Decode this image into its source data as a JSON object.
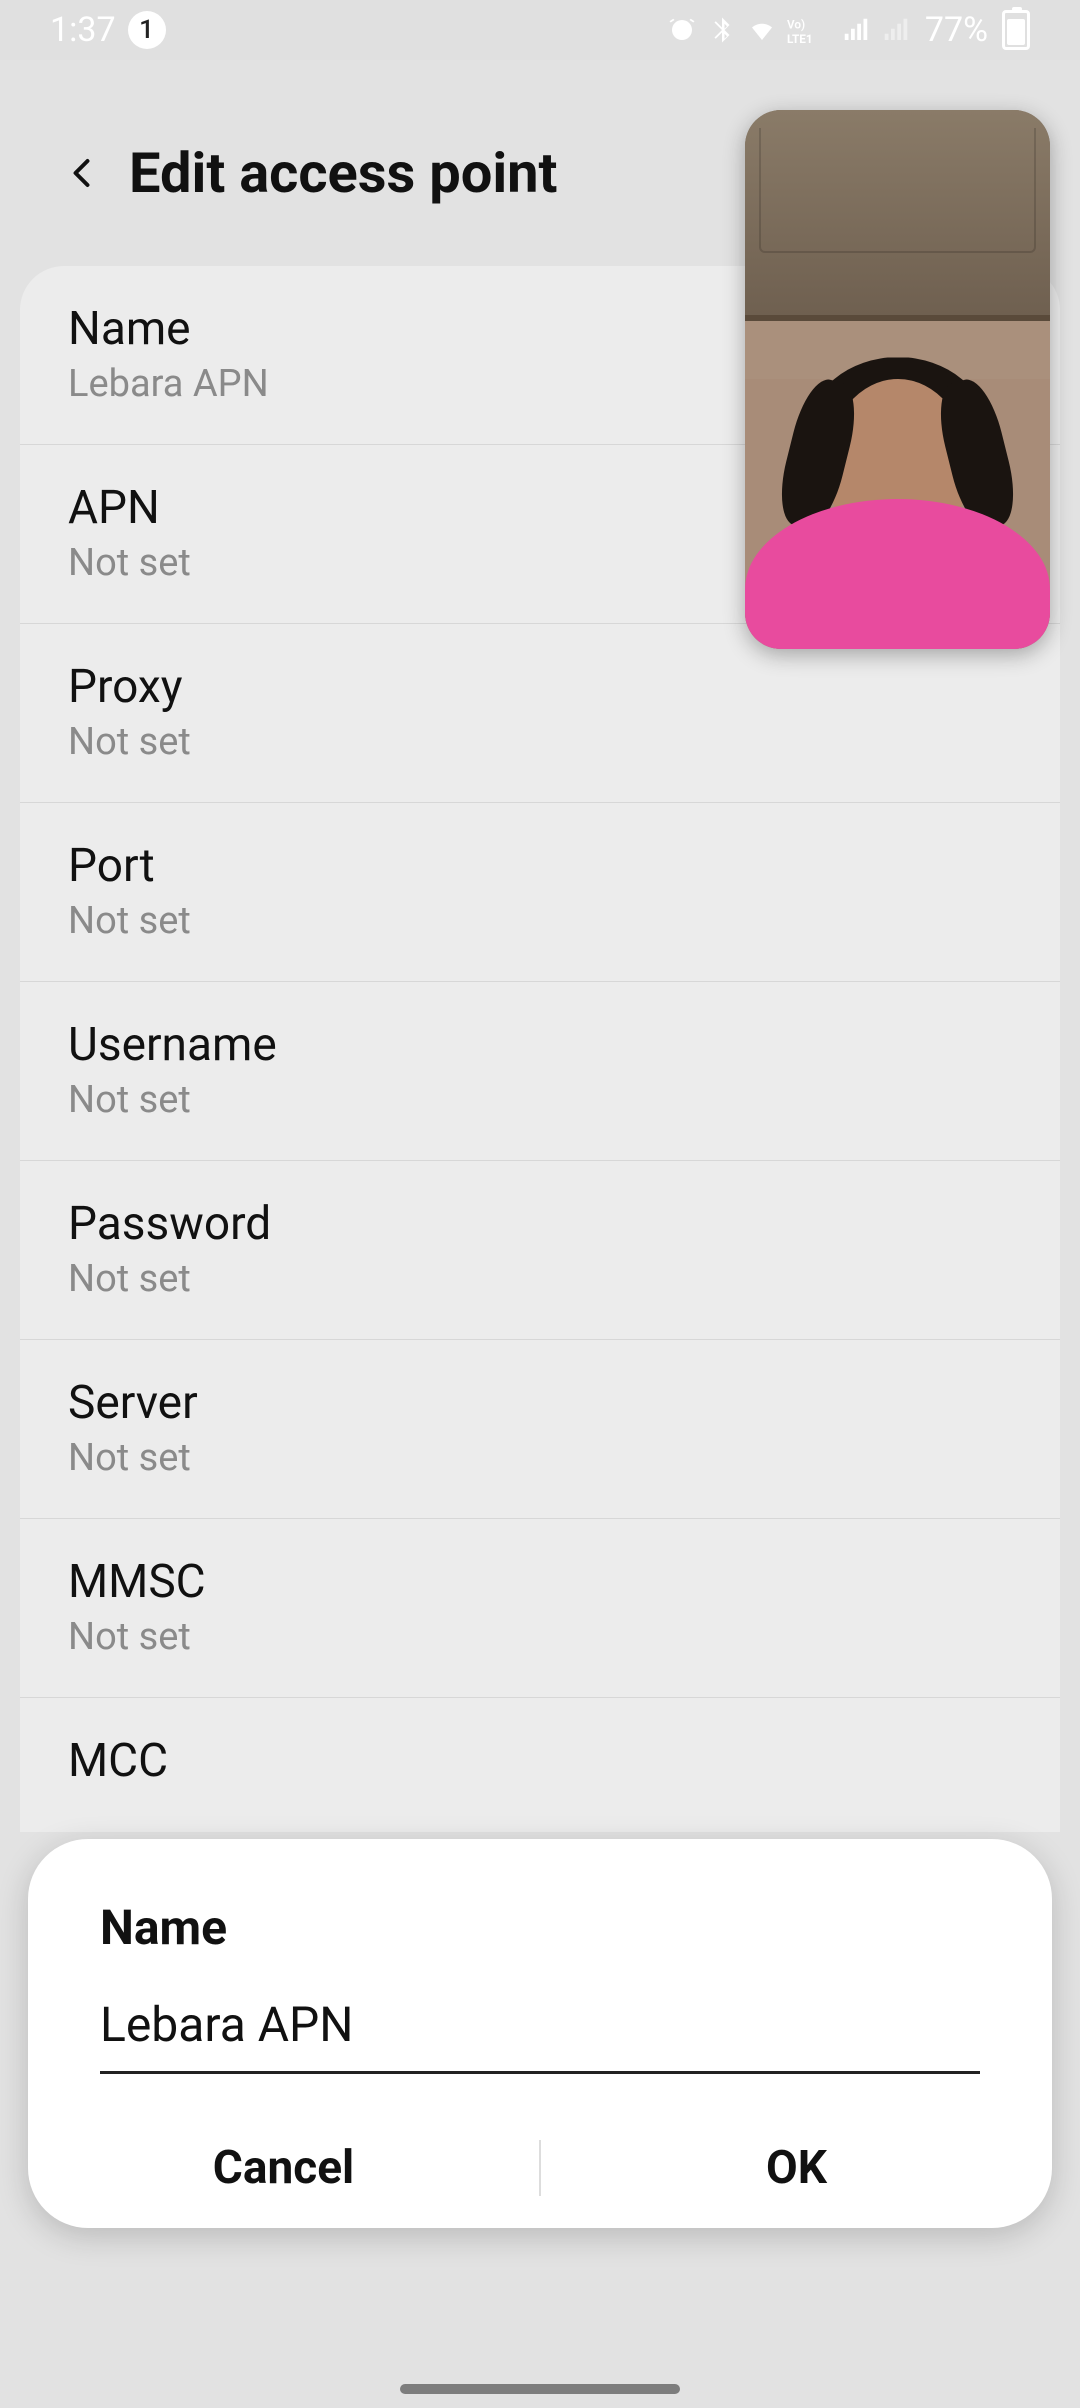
{
  "status_bar": {
    "time": "1:37",
    "notif_count": "1",
    "battery_pct": "77%"
  },
  "header": {
    "title": "Edit access point"
  },
  "rows": [
    {
      "label": "Name",
      "value": "Lebara APN"
    },
    {
      "label": "APN",
      "value": "Not set"
    },
    {
      "label": "Proxy",
      "value": "Not set"
    },
    {
      "label": "Port",
      "value": "Not set"
    },
    {
      "label": "Username",
      "value": "Not set"
    },
    {
      "label": "Password",
      "value": "Not set"
    },
    {
      "label": "Server",
      "value": "Not set"
    },
    {
      "label": "MMSC",
      "value": "Not set"
    },
    {
      "label": "MCC",
      "value": ""
    }
  ],
  "dialog": {
    "title": "Name",
    "value": "Lebara APN",
    "cancel": "Cancel",
    "ok": "OK"
  }
}
